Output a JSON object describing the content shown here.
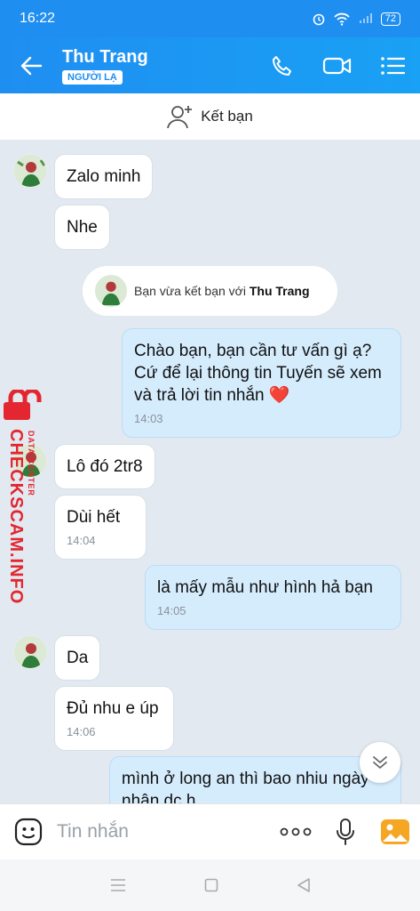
{
  "status": {
    "time": "16:22",
    "battery": "72"
  },
  "header": {
    "name": "Thu Trang",
    "badge": "NGƯỜI LẠ"
  },
  "add_friend": {
    "label": "Kết bạn"
  },
  "system_note": {
    "prefix": "Bạn vừa kết bạn với",
    "name": "Thu Trang"
  },
  "messages": [
    {
      "side": "them",
      "text": "Zalo minh"
    },
    {
      "side": "them",
      "text": "Nhe"
    },
    {
      "side": "me",
      "text": "Chào bạn, bạn cần tư vấn gì ạ? Cứ để lại thông tin Tuyến sẽ xem và trả lời tin nhắn",
      "emoji": "❤️",
      "time": "14:03"
    },
    {
      "side": "them",
      "text": "Lô đó 2tr8"
    },
    {
      "side": "them",
      "text": "Dùi hết",
      "time": "14:04"
    },
    {
      "side": "me",
      "text": "là mấy mẫu như hình hả bạn",
      "time": "14:05"
    },
    {
      "side": "them",
      "text": "Da"
    },
    {
      "side": "them",
      "text": "Đủ nhu e úp",
      "time": "14:06"
    },
    {
      "side": "me",
      "text": "mình ở long an thì bao nhiu ngày nhận dc h"
    }
  ],
  "watermark": {
    "brand": "CHECKSCAM.INFO",
    "sub": "DATA CENTER"
  },
  "input": {
    "placeholder": "Tin nhắn"
  },
  "colors": {
    "header": "#1f8ef1",
    "my_bubble": "#d5ecfd",
    "background": "#e2e9f1",
    "watermark": "#e3262f"
  }
}
